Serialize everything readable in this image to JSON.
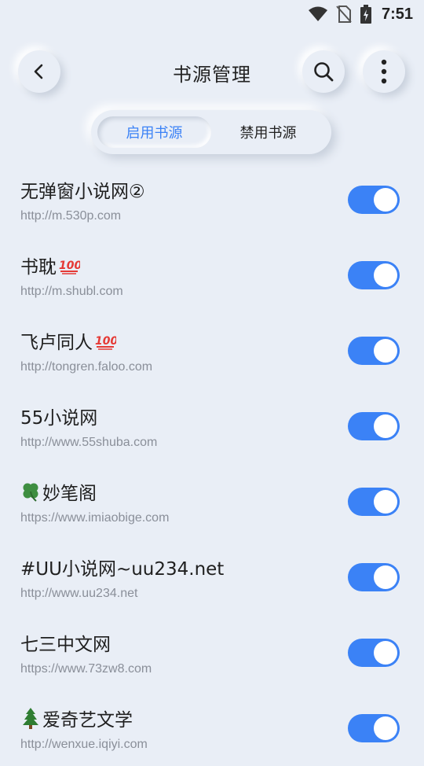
{
  "status_bar": {
    "time": "7:51",
    "icons": [
      "wifi-icon",
      "no-sim-icon",
      "battery-charging-icon"
    ]
  },
  "header": {
    "title": "书源管理",
    "back_icon": "chevron-left-icon",
    "search_icon": "search-icon",
    "more_icon": "more-vertical-icon"
  },
  "tabs": [
    {
      "label": "启用书源",
      "active": true
    },
    {
      "label": "禁用书源",
      "active": false
    }
  ],
  "accent_color": "#3b82f6",
  "sources": [
    {
      "name": "无弹窗小说网②",
      "url": "http://m.530p.com",
      "enabled": true,
      "icon": ""
    },
    {
      "name": "书耽",
      "url": "http://m.shubl.com",
      "enabled": true,
      "icon": "hundred-points-icon",
      "icon_position": "after"
    },
    {
      "name": "飞卢同人",
      "url": "http://tongren.faloo.com",
      "enabled": true,
      "icon": "hundred-points-icon",
      "icon_position": "after"
    },
    {
      "name": "55小说网",
      "url": "http://www.55shuba.com",
      "enabled": true,
      "icon": ""
    },
    {
      "name": "妙笔阁",
      "url": "https://www.imiaobige.com",
      "enabled": true,
      "icon": "four-leaf-clover-icon",
      "icon_position": "before"
    },
    {
      "name": "#UU小说网~uu234.net",
      "url": "http://www.uu234.net",
      "enabled": true,
      "icon": ""
    },
    {
      "name": "七三中文网",
      "url": "https://www.73zw8.com",
      "enabled": true,
      "icon": ""
    },
    {
      "name": "爱奇艺文学",
      "url": "http://wenxue.iqiyi.com",
      "enabled": true,
      "icon": "evergreen-tree-icon",
      "icon_position": "before"
    }
  ]
}
